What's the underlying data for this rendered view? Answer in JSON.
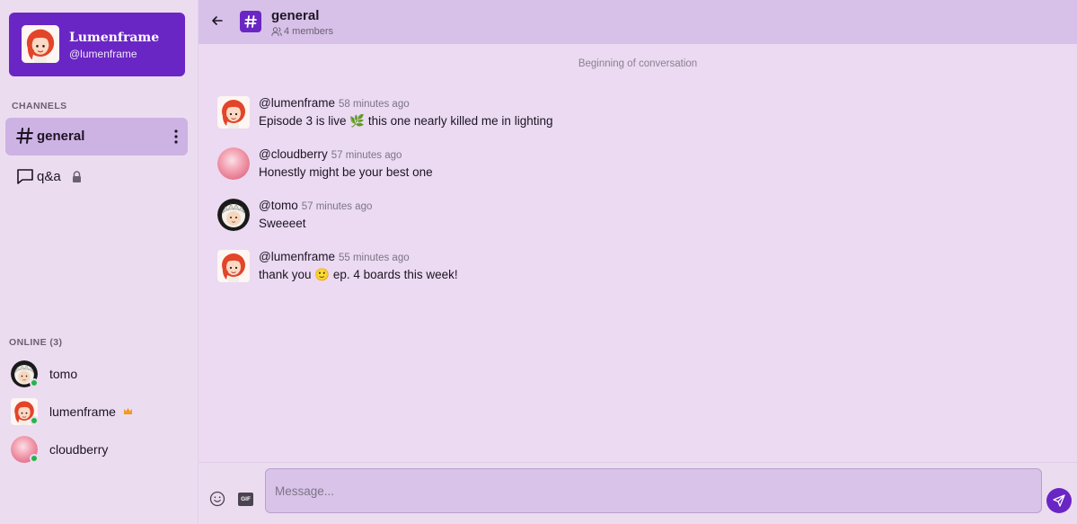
{
  "profile": {
    "name": "Lumenframe",
    "handle": "@lumenframe"
  },
  "sidebar": {
    "channels_label": "CHANNELS",
    "channels": [
      {
        "name": "general",
        "icon": "hash-icon",
        "active": true
      },
      {
        "name": "q&a",
        "icon": "chat-bubble-icon",
        "locked": true
      }
    ],
    "online_label": "ONLINE (3)",
    "members": [
      {
        "name": "tomo",
        "status": "online"
      },
      {
        "name": "lumenframe",
        "status": "online",
        "badge": "crown-icon"
      },
      {
        "name": "cloudberry",
        "status": "online"
      }
    ]
  },
  "header": {
    "title": "general",
    "members": "4 members"
  },
  "conversation": {
    "start_label": "Beginning of conversation",
    "messages": [
      {
        "author": "@lumenframe",
        "time": "58 minutes ago",
        "text": "Episode 3 is live 🌿 this one nearly killed me in lighting"
      },
      {
        "author": "@cloudberry",
        "time": "57 minutes ago",
        "text": "Honestly might be your best one"
      },
      {
        "author": "@tomo",
        "time": "57 minutes ago",
        "text": "Sweeeet"
      },
      {
        "author": "@lumenframe",
        "time": "55 minutes ago",
        "text": "thank you 🙂 ep. 4 boards this week!"
      }
    ]
  },
  "composer": {
    "placeholder": "Message...",
    "gif_label": "GIF"
  },
  "colors": {
    "accent": "#6a26c4",
    "online": "#23b54b",
    "background": "#ecdcf0"
  }
}
